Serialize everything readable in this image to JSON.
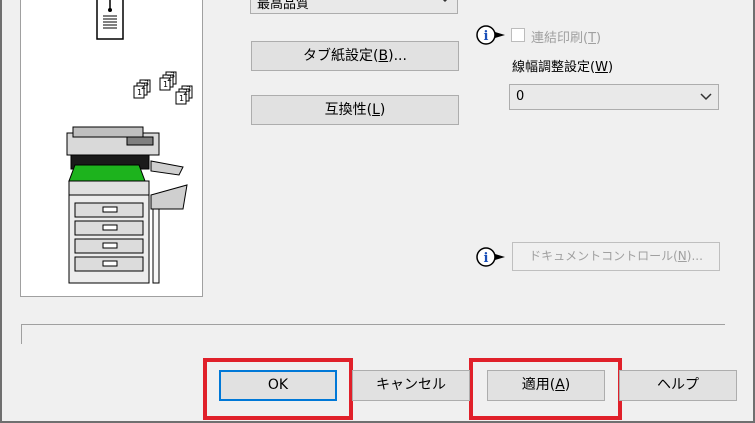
{
  "print_quality": {
    "value": "最高品質"
  },
  "tab_paper": {
    "label": "タブ紙設定(",
    "key": "B",
    "suffix": ")..."
  },
  "compatibility": {
    "label": "互換性(",
    "key": "L",
    "suffix": ")"
  },
  "linked_print": {
    "label": "連結印刷(",
    "key": "T",
    "suffix": ")",
    "checked": false,
    "enabled": false
  },
  "line_width": {
    "label": "線幅調整設定(",
    "key": "W",
    "suffix": ")",
    "value": "0"
  },
  "document_control": {
    "label": "ドキュメントコントロール(",
    "key": "N",
    "suffix": ")..."
  },
  "footer": {
    "ok": "OK",
    "cancel": "キャンセル",
    "apply": {
      "label": "適用(",
      "key": "A",
      "suffix": ")"
    },
    "help": "ヘルプ"
  },
  "icons": {
    "info": "info-icon",
    "chevron": "chevron-down-icon",
    "document": "document-icon",
    "copies": "sorted-copies-icon",
    "printer": "printer-illustration"
  },
  "colors": {
    "highlight": "#e0202a",
    "focus": "#0078d7"
  }
}
